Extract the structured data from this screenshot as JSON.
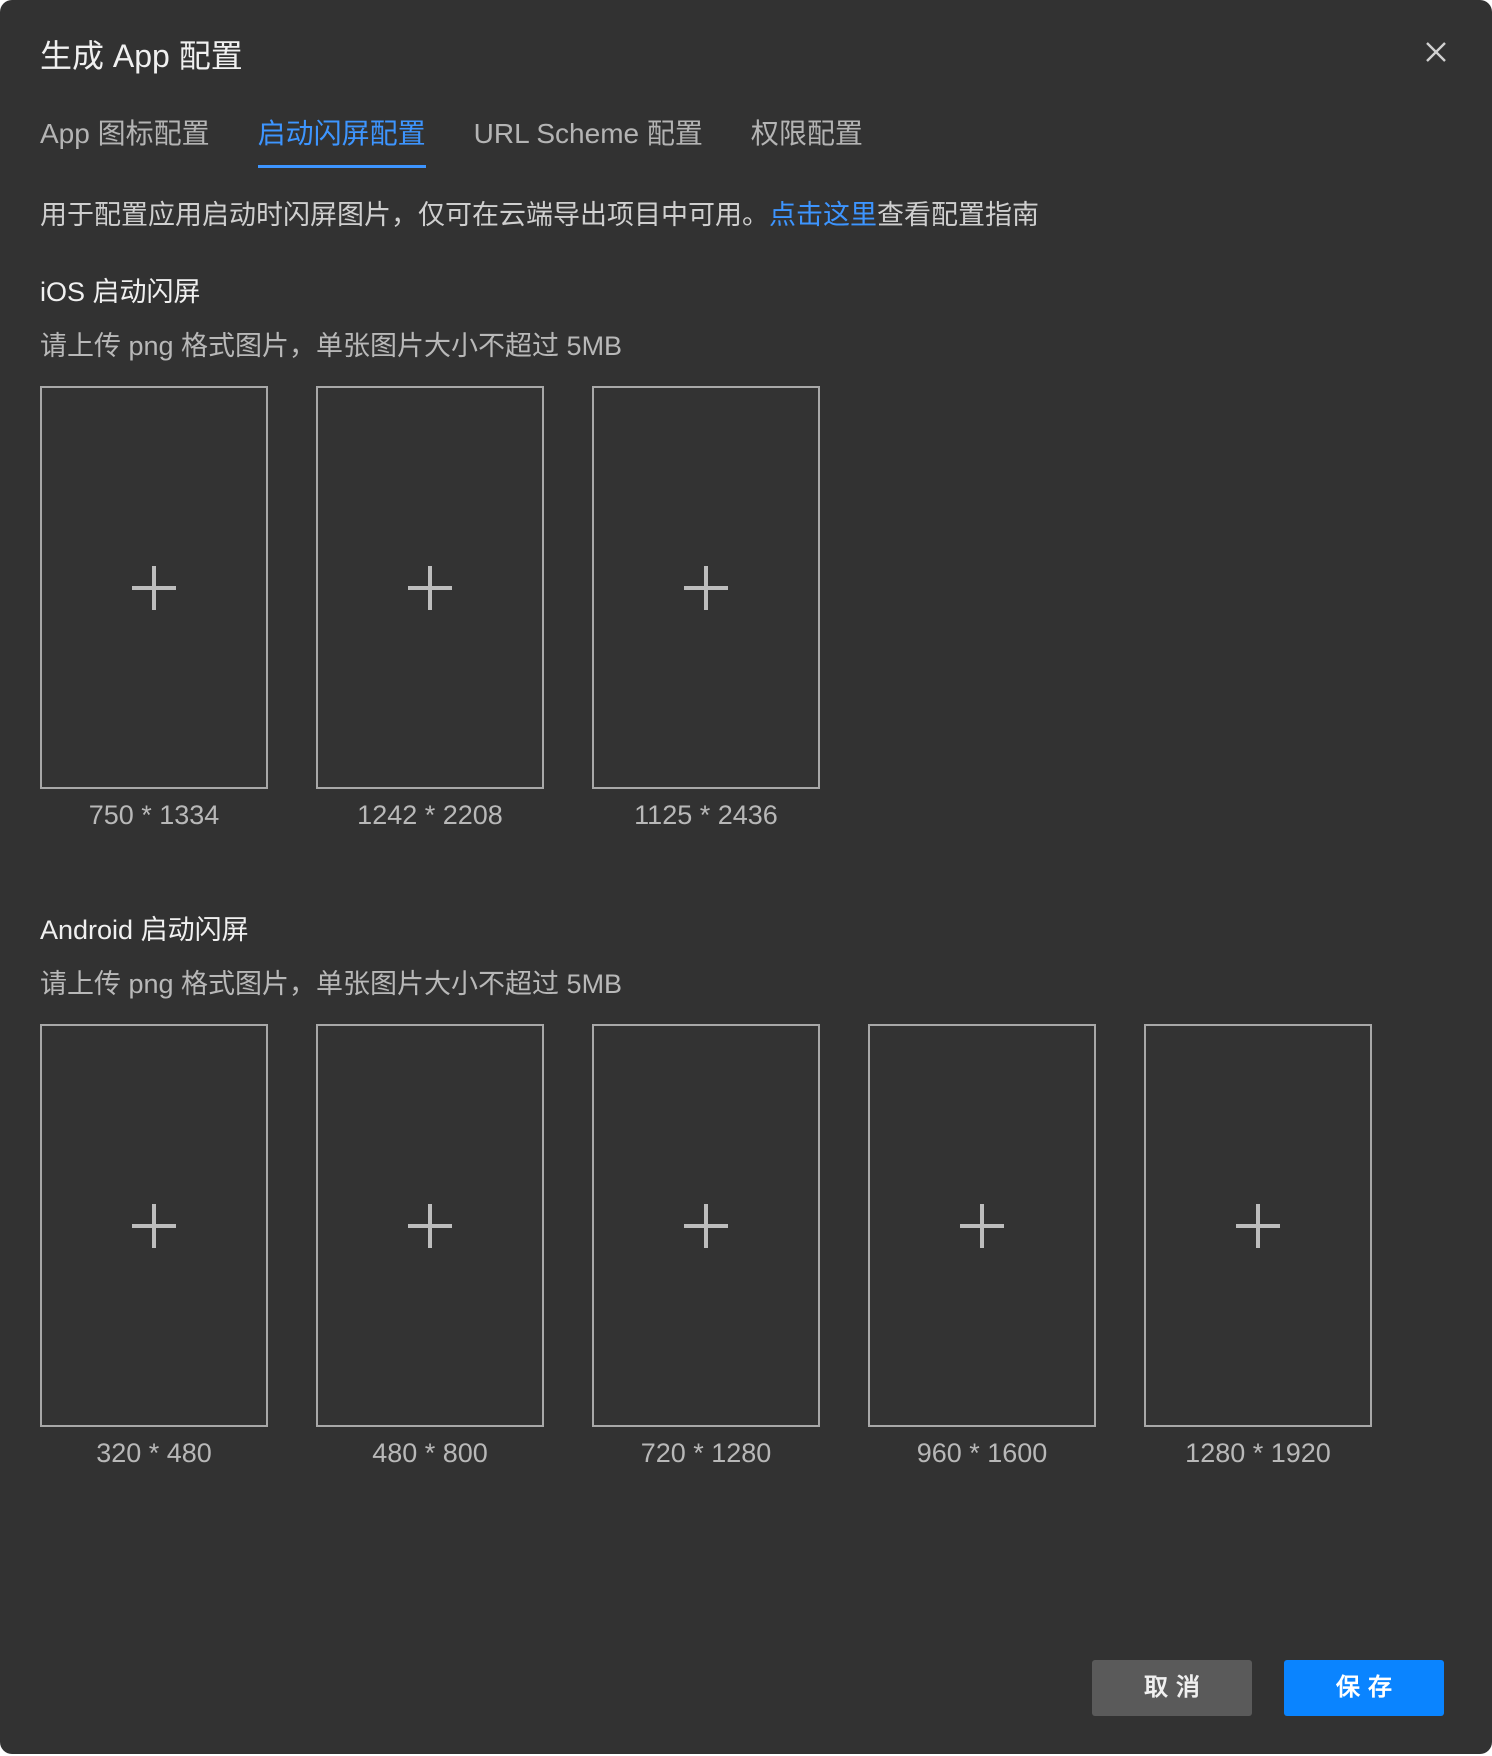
{
  "dialog": {
    "title": "生成 App 配置"
  },
  "tabs": [
    {
      "label": "App 图标配置",
      "active": false
    },
    {
      "label": "启动闪屏配置",
      "active": true
    },
    {
      "label": "URL Scheme 配置",
      "active": false
    },
    {
      "label": "权限配置",
      "active": false
    }
  ],
  "description": {
    "text_before": "用于配置应用启动时闪屏图片，仅可在云端导出项目中可用。",
    "link": "点击这里",
    "text_after": "查看配置指南"
  },
  "ios": {
    "title": "iOS 启动闪屏",
    "hint": "请上传 png 格式图片，单张图片大小不超过 5MB",
    "sizes": [
      "750 * 1334",
      "1242 * 2208",
      "1125 * 2436"
    ]
  },
  "android": {
    "title": "Android 启动闪屏",
    "hint": "请上传 png 格式图片，单张图片大小不超过 5MB",
    "sizes": [
      "320 * 480",
      "480 * 800",
      "720 * 1280",
      "960 * 1600",
      "1280 * 1920"
    ]
  },
  "footer": {
    "cancel_label": "取消",
    "save_label": "保存"
  },
  "colors": {
    "background": "#323232",
    "accent": "#3d95ff",
    "save_button": "#0a84ff",
    "cancel_button": "#5a5a5a"
  },
  "icons": {
    "close": "close-icon",
    "upload": "plus-icon"
  }
}
